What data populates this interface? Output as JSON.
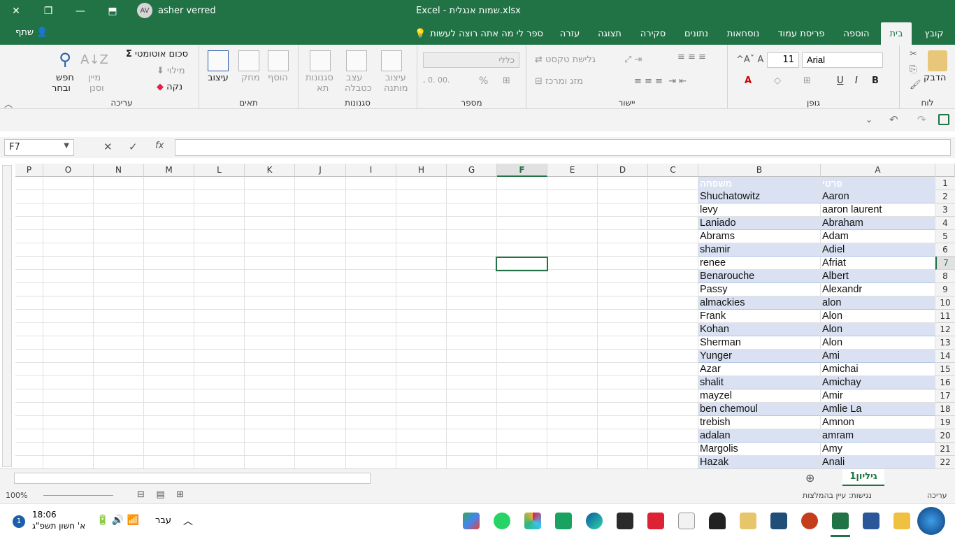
{
  "app": {
    "title": "Excel - שמות אנגלית.xlsx",
    "user": "asher verred",
    "initials": "AV"
  },
  "window": {
    "restore_icon": "restore-icon",
    "close_icon": "close-icon",
    "minimize_icon": "minimize-icon",
    "ribbon_display_icon": "ribbon-display-icon"
  },
  "tabs": [
    "קובץ",
    "בית",
    "הוספה",
    "פריסת עמוד",
    "נוסחאות",
    "נתונים",
    "סקירה",
    "תצוגה",
    "עזרה"
  ],
  "tell_me": "ספר לי מה אתה רוצה לעשות",
  "share": "שתף",
  "ribbon": {
    "clipboard": {
      "label": "לוח",
      "paste": "הדבק"
    },
    "font": {
      "label": "גופן",
      "name": "Arial",
      "size": "11",
      "bold": "B",
      "italic": "I",
      "underline": "U"
    },
    "alignment": {
      "label": "יישור",
      "wrap": "גלישת טקסט",
      "merge": "מזג ומרכז"
    },
    "number": {
      "label": "מספר",
      "format": "כללי",
      "percent": "%",
      "comma": ","
    },
    "styles": {
      "label": "סגנונות",
      "cond": [
        "עיצוב",
        "מותנה"
      ],
      "table": [
        "עצב",
        "כטבלה"
      ],
      "cell": [
        "סגנונות",
        "תא"
      ]
    },
    "cells": {
      "label": "תאים",
      "insert": "הוסף",
      "delete": "מחק",
      "format": "עיצוב"
    },
    "editing": {
      "label": "עריכה",
      "autosum": "סכום אוטומטי",
      "fill": "מילוי",
      "clear": "נקה",
      "sort": [
        "מיין",
        "וסנן"
      ],
      "find": [
        "חפש",
        "ובחר"
      ]
    }
  },
  "formula_bar": {
    "name_box": "F7",
    "fx": "fx"
  },
  "columns": [
    "A",
    "B",
    "C",
    "D",
    "E",
    "F",
    "G",
    "H",
    "I",
    "J",
    "K",
    "L",
    "M",
    "N",
    "O",
    "P"
  ],
  "rows": [
    "1",
    "2",
    "3",
    "4",
    "5",
    "6",
    "7",
    "8",
    "9",
    "10",
    "11",
    "12",
    "13",
    "14",
    "15",
    "16",
    "17",
    "18",
    "19",
    "20",
    "21",
    "22"
  ],
  "table": {
    "headers": [
      "פרטי",
      "משפחה"
    ],
    "data": [
      [
        "Aaron",
        "Shuchatowitz"
      ],
      [
        "aaron laurent",
        "levy"
      ],
      [
        "Abraham",
        "Laniado"
      ],
      [
        "Adam",
        "Abrams"
      ],
      [
        "Adiel",
        "shamir"
      ],
      [
        "Afriat",
        "renee"
      ],
      [
        "Albert",
        "Benarouche"
      ],
      [
        "Alexandr",
        "Passy"
      ],
      [
        "alon",
        "almackies"
      ],
      [
        "Alon",
        "Frank"
      ],
      [
        "Alon",
        "Kohan"
      ],
      [
        "Alon",
        "Sherman"
      ],
      [
        "Ami",
        "Yunger"
      ],
      [
        "Amichai",
        "Azar"
      ],
      [
        "Amichay",
        "shalit"
      ],
      [
        "Amir",
        "mayzel"
      ],
      [
        "Amlie La",
        "ben chemoul"
      ],
      [
        "Amnon",
        "trebish"
      ],
      [
        "amram",
        "adalan"
      ],
      [
        "Amy",
        "Margolis"
      ],
      [
        "Anali",
        "Hazak"
      ]
    ]
  },
  "sheet": {
    "tab": "גיליון1"
  },
  "status": {
    "mode": "עריכה",
    "accessibility": "נגישות: עיין בהמלצות",
    "zoom": "100%"
  },
  "taskbar": {
    "time": "18:06",
    "date": "א' חשון תשפ\"ג",
    "lang": "עבר",
    "notif": "1"
  },
  "colors": {
    "accent": "#217346",
    "band": "#d9e1f2"
  }
}
